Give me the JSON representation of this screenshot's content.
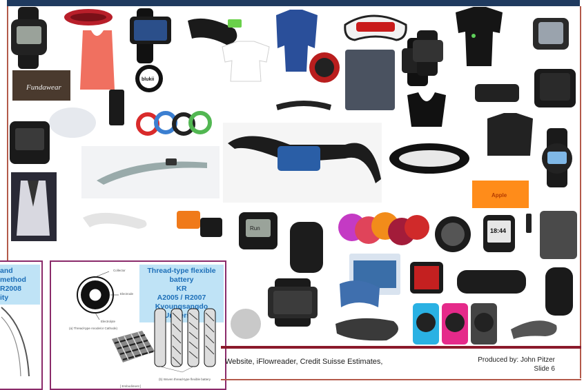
{
  "footer": {
    "sources": "Website, iFlowreader, Credit Suisse Estimates,",
    "producer": "Produced by: John Pitzer",
    "slide": "Slide 6"
  },
  "product_labels": {
    "fundawear": "Fundawear",
    "bluki": "blukii",
    "band_reading": "Run",
    "watch_time": "18:44",
    "orange_watch_word": "Apple"
  },
  "inset_left": {
    "title_lines": [
      "and method",
      "R2008",
      "ity"
    ]
  },
  "inset_right": {
    "title_lines": [
      "Thread-type flexible battery",
      "KR",
      "A2005 / R2007",
      "Kyoungsangdo University"
    ],
    "label_collector": "Collector",
    "label_electrolyte": "Electrolyte",
    "label_electrode": "Electrode",
    "caption_cathode": "(a) Thread-type Anode/or Cathode)",
    "caption_woven": "(b) Woven thread-type flexible battery",
    "caption_embodiment": "[ Embodiment ]"
  },
  "colors": {
    "top_rule": "#1f3a5f",
    "frame": "#b35a4a",
    "bottom_rule": "#8b1a2b",
    "inset_border": "#8a2a6a",
    "inset_title_bg": "#bfe3f6",
    "inset_title_text": "#1d6fb8"
  }
}
